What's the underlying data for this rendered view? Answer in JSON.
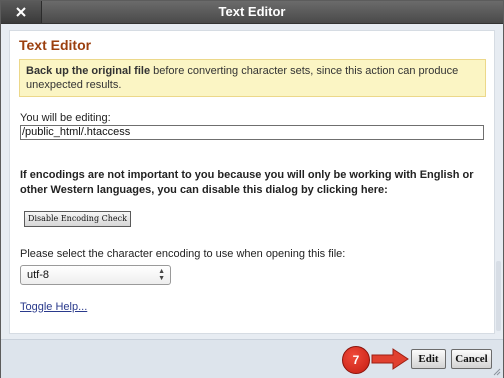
{
  "window": {
    "title": "Text Editor",
    "close_icon": "close-icon"
  },
  "content": {
    "heading": "Text Editor",
    "warning": {
      "bold": "Back up the original file",
      "rest": " before converting character sets, since this action can produce unexpected results."
    },
    "editing_label": "You will be editing:",
    "file_path": "/public_html/.htaccess",
    "encoding_note": "If encodings are not important to you because you will only be working with English or other Western languages, you can disable this dialog by clicking here:",
    "disable_button_label": "Disable Encoding Check",
    "encoding_prompt": "Please select the character encoding to use when opening this file:",
    "encoding_selected": "utf-8",
    "toggle_help_label": "Toggle Help..."
  },
  "footer": {
    "step_number": "7",
    "edit_label": "Edit",
    "cancel_label": "Cancel"
  },
  "colors": {
    "heading": "#9b3f0e",
    "warning_bg": "#fbf5c4",
    "badge": "#d9271a",
    "arrow": "#e0402f"
  }
}
